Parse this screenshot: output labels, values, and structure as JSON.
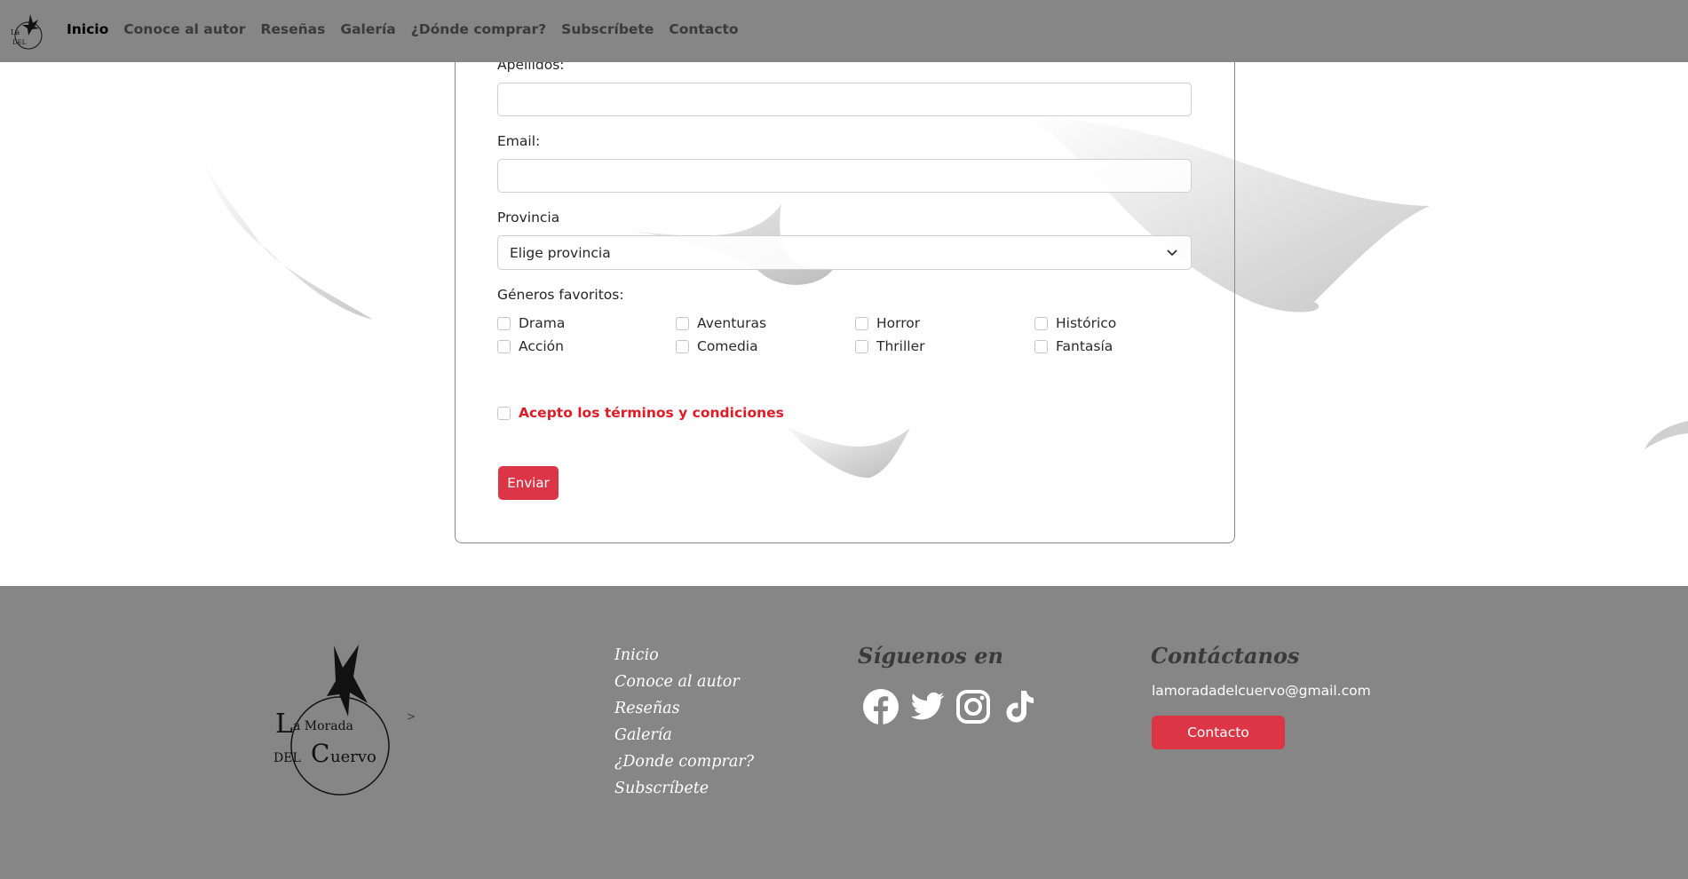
{
  "nav": {
    "logo_alt": "La Morada del Cuervo",
    "links": [
      "Inicio",
      "Conoce al autor",
      "Reseñas",
      "Galería",
      "¿Dónde comprar?",
      "Subscríbete",
      "Contacto"
    ]
  },
  "form": {
    "apellidos_label": "Apellidos:",
    "email_label": "Email:",
    "provincia_label": "Provincia",
    "provincia_selected": "Elige provincia",
    "generos_label": "Géneros favoritos:",
    "generos": [
      "Drama",
      "Aventuras",
      "Horror",
      "Histórico",
      "Acción",
      "Comedia",
      "Thriller",
      "Fantasía"
    ],
    "terms_label": "Acepto los términos y condiciones",
    "submit_label": "Enviar"
  },
  "footer": {
    "logo_alt": "La Morada del Cuervo",
    "arrow": ">",
    "links": [
      "Inicio",
      "Conoce al autor",
      "Reseñas",
      "Galería",
      "¿Donde comprar?",
      "Subscríbete"
    ],
    "social_heading": "Síguenos en",
    "social_icons": [
      "facebook-icon",
      "twitter-icon",
      "instagram-icon",
      "tiktok-icon"
    ],
    "contact_heading": "Contáctanos",
    "email": "lamoradadelcuervo@gmail.com",
    "contact_button": "Contacto"
  },
  "colors": {
    "nav_bg": "#868686",
    "footer_bg": "#868686",
    "accent_red": "#dc3545",
    "terms_red": "#e01b24"
  }
}
